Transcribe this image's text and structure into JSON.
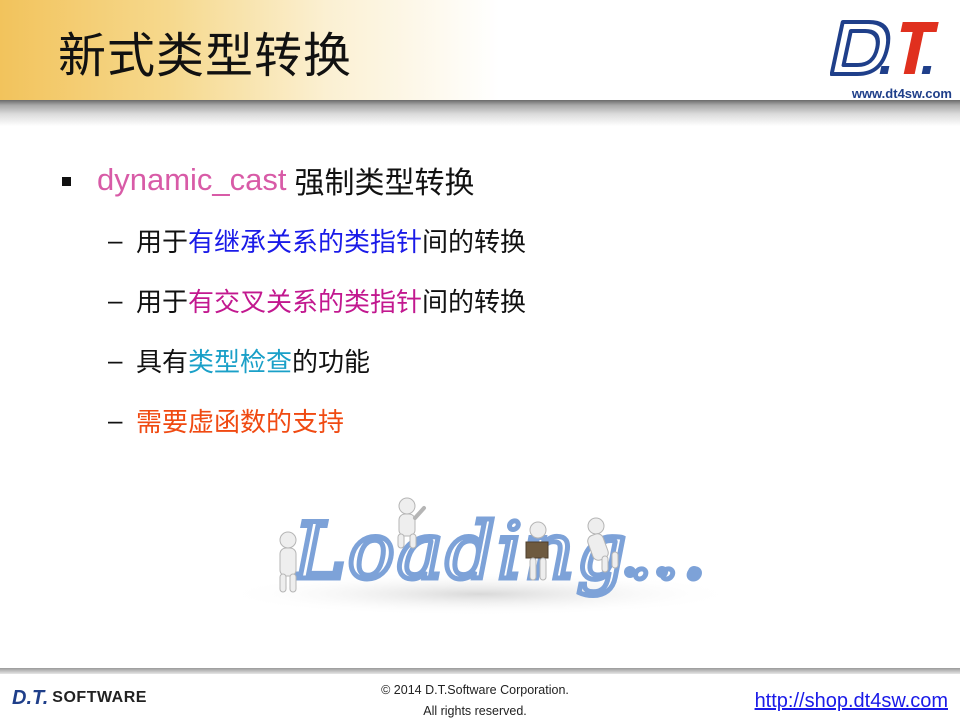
{
  "header": {
    "title": "新式类型转换",
    "logo_text": "D.T.",
    "logo_url": "www.dt4sw.com"
  },
  "bullets": {
    "main": {
      "keyword": "dynamic_cast",
      "text": "强制类型转换"
    },
    "sub_items": [
      {
        "prefix": "用于",
        "highlight": "有继承关系的类指针",
        "suffix": "间的转换",
        "color": "#1a1ae8"
      },
      {
        "prefix": "用于",
        "highlight": "有交叉关系的类指针",
        "suffix": "间的转换",
        "color": "#c2188f"
      },
      {
        "prefix": "具有",
        "highlight": "类型检查",
        "suffix": "的功能",
        "color": "#1aa0c8"
      },
      {
        "prefix": "",
        "highlight": "需要虚函数的支持",
        "suffix": "",
        "color": "#f04a12"
      }
    ]
  },
  "illustration": {
    "text": "Loading...",
    "color": "#7da2d8"
  },
  "footer": {
    "logo_main": "D.T.",
    "logo_soft": "SOFTWARE",
    "copyright_line1": "© 2014 D.T.Software Corporation.",
    "copyright_line2": "All rights reserved.",
    "shop_link": "http://shop.dt4sw.com"
  },
  "colors": {
    "header_gold": "#f2c35c",
    "brand_blue": "#1f3f8a",
    "brand_red": "#e0301e",
    "keyword_pink": "#d85ba7"
  }
}
